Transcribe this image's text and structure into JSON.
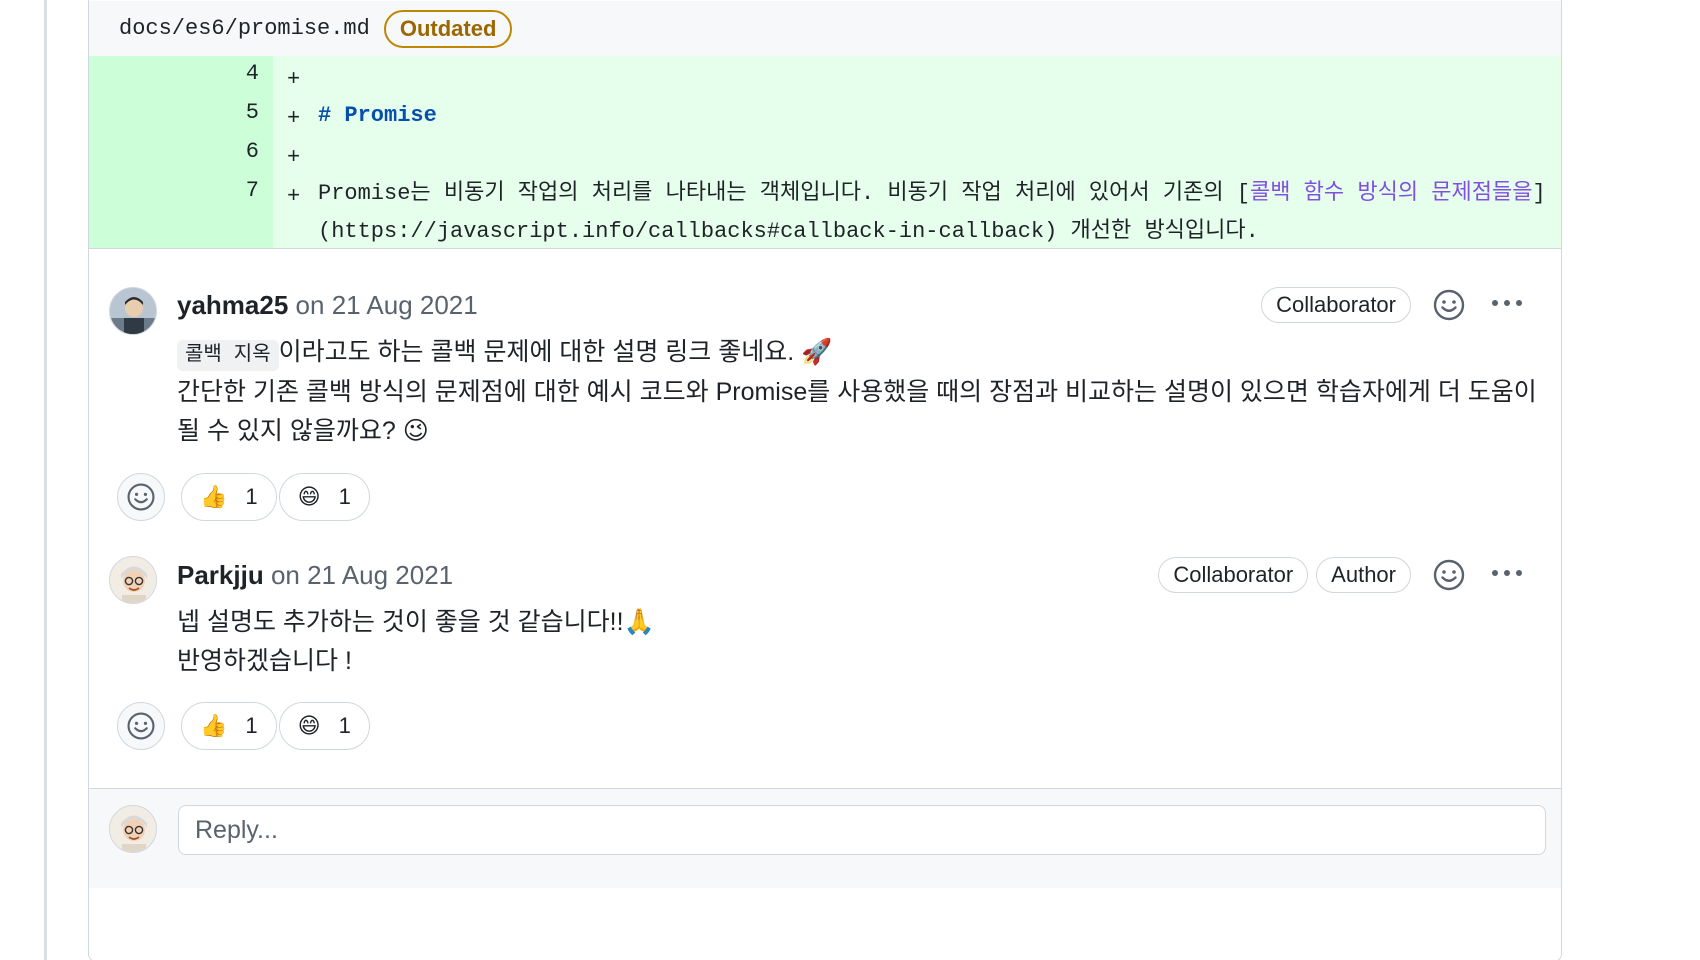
{
  "file": {
    "path": "docs/es6/promise.md",
    "status_badge": "Outdated"
  },
  "diff": {
    "lines": [
      {
        "num": "4",
        "sign": "+",
        "text": ""
      },
      {
        "num": "5",
        "sign": "+",
        "text": "# Promise"
      },
      {
        "num": "6",
        "sign": "+",
        "text": ""
      },
      {
        "num": "7",
        "sign": "+",
        "text_before": "Promise는 비동기 작업의 처리를 나타내는 객체입니다. 비동기 작업 처리에 있어서 기존의 [",
        "link_text": "콜백 함수 방식의 문제점들을",
        "text_after": "]",
        "continuation": "(https://javascript.info/callbacks#callback-in-callback) 개선한 방식입니다."
      }
    ]
  },
  "comments": [
    {
      "author": "yahma25",
      "date": "on 21 Aug 2021",
      "badges": [
        "Collaborator"
      ],
      "inline_code": "콜백 지옥",
      "line1_rest": "이라고도 하는 콜백 문제에 대한 설명 링크 좋네요. 🚀",
      "line2": "간단한 기존 콜백 방식의 문제점에 대한 예시 코드와 Promise를 사용했을 때의 장점과 비교하는 설명이 있으면 학습자에게 더 도움이",
      "line3": "될 수 있지 않을까요? 😉",
      "reactions": [
        {
          "emoji": "👍",
          "count": "1"
        },
        {
          "emoji": "😄",
          "count": "1"
        }
      ]
    },
    {
      "author": "Parkjju",
      "date": "on 21 Aug 2021",
      "badges": [
        "Collaborator",
        "Author"
      ],
      "line1": "넵 설명도 추가하는 것이 좋을 것 같습니다!!🙏",
      "line2": "반영하겠습니다 !",
      "reactions": [
        {
          "emoji": "👍",
          "count": "1"
        },
        {
          "emoji": "😄",
          "count": "1"
        }
      ]
    }
  ],
  "reply": {
    "placeholder": "Reply..."
  },
  "icons": {
    "add_reaction": "smiley-icon",
    "more": "kebab-horizontal-icon"
  },
  "colors": {
    "diff_added_bg": "#e6ffec",
    "diff_gutter_bg": "#ccffd8",
    "outdated": "#9a6700",
    "link": "#8250df",
    "heading": "#0550ae"
  }
}
